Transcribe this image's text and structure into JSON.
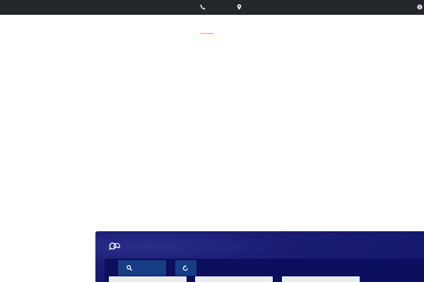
{
  "topbar": {
    "icons": [
      "phone-icon",
      "location-pin-icon",
      "info-icon"
    ],
    "background": "#23272b"
  },
  "accent": {
    "color": "#f0a51f"
  },
  "search_panel": {
    "icon": "car-search-icon",
    "background": "#111566",
    "toolbar": {
      "search_button_icon": "search-icon",
      "reset_button_icon": "refresh-icon",
      "button_color": "#163d86"
    },
    "fields": [
      {
        "value": ""
      },
      {
        "value": ""
      },
      {
        "value": ""
      }
    ]
  }
}
